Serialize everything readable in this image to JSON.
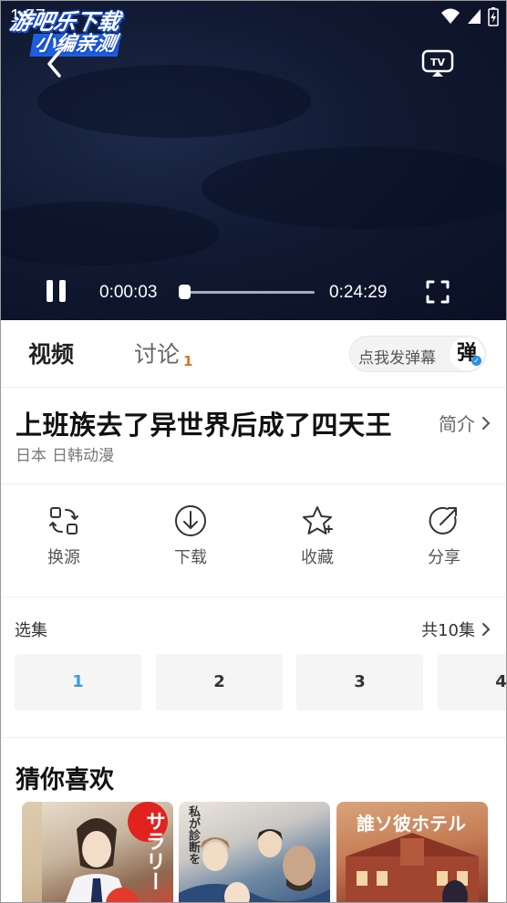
{
  "status_bar": {
    "time": "1:57"
  },
  "watermark": {
    "line1": "游吧乐下载",
    "line2": "小编亲测"
  },
  "player": {
    "current_time": "0:00:03",
    "total_time": "0:24:29",
    "progress": 0.002
  },
  "tabs": {
    "video": "视频",
    "discussion": "讨论",
    "discussion_count": "1",
    "danmaku_label": "点我发弹幕",
    "danmaku_icon": "弹"
  },
  "info": {
    "title": "上班族去了异世界后成了四天王",
    "intro_link": "简介",
    "region": "日本",
    "category": "日韩动漫"
  },
  "actions": [
    {
      "label": "换源",
      "icon": "switch-source-icon"
    },
    {
      "label": "下载",
      "icon": "download-icon"
    },
    {
      "label": "收藏",
      "icon": "star-icon"
    },
    {
      "label": "分享",
      "icon": "share-icon"
    }
  ],
  "episodes": {
    "title": "选集",
    "total": "共10集",
    "items": [
      "1",
      "2",
      "3",
      "4"
    ],
    "active_index": 0
  },
  "recommend": {
    "title": "猜你喜欢",
    "cards": [
      {
        "caption": "サラリー"
      },
      {
        "caption": "私が診断を"
      },
      {
        "caption": "誰ソ彼ホテル"
      }
    ]
  },
  "colors": {
    "accent": "#3a9be0",
    "count": "#e07020"
  }
}
